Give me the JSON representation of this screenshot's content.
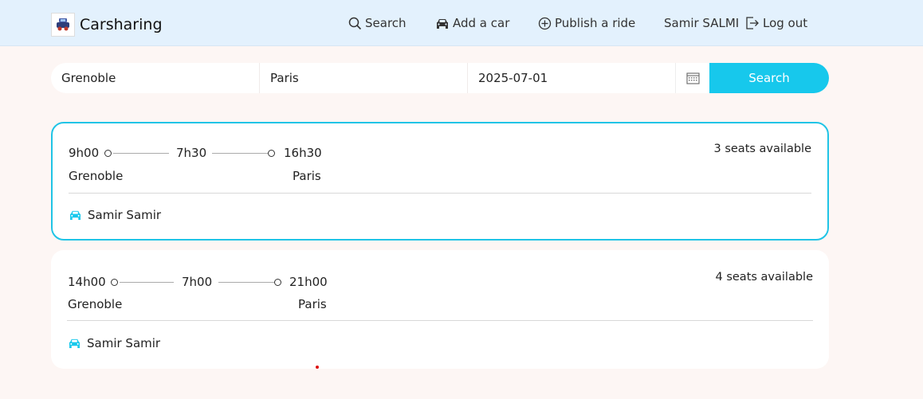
{
  "navbar": {
    "brand": "Carsharing",
    "links": {
      "search": "Search",
      "add_car": "Add a car",
      "publish_ride": "Publish a ride"
    },
    "user_name": "Samir SALMI",
    "logout": "Log out"
  },
  "search_form": {
    "from": "Grenoble",
    "to": "Paris",
    "date": "2025-07-01",
    "button": "Search"
  },
  "rides": [
    {
      "departure_time": "9h00",
      "duration": "7h30",
      "arrival_time": "16h30",
      "from": "Grenoble",
      "to": "Paris",
      "seats": "3 seats available",
      "driver": "Samir Samir",
      "selected": true
    },
    {
      "departure_time": "14h00",
      "duration": "7h00",
      "arrival_time": "21h00",
      "from": "Grenoble",
      "to": "Paris",
      "seats": "4 seats available",
      "driver": "Samir Samir",
      "selected": false
    }
  ],
  "colors": {
    "navbar_bg": "#e3f1fd",
    "accent": "#17c8ec",
    "page_bg": "#fdf6f4"
  }
}
